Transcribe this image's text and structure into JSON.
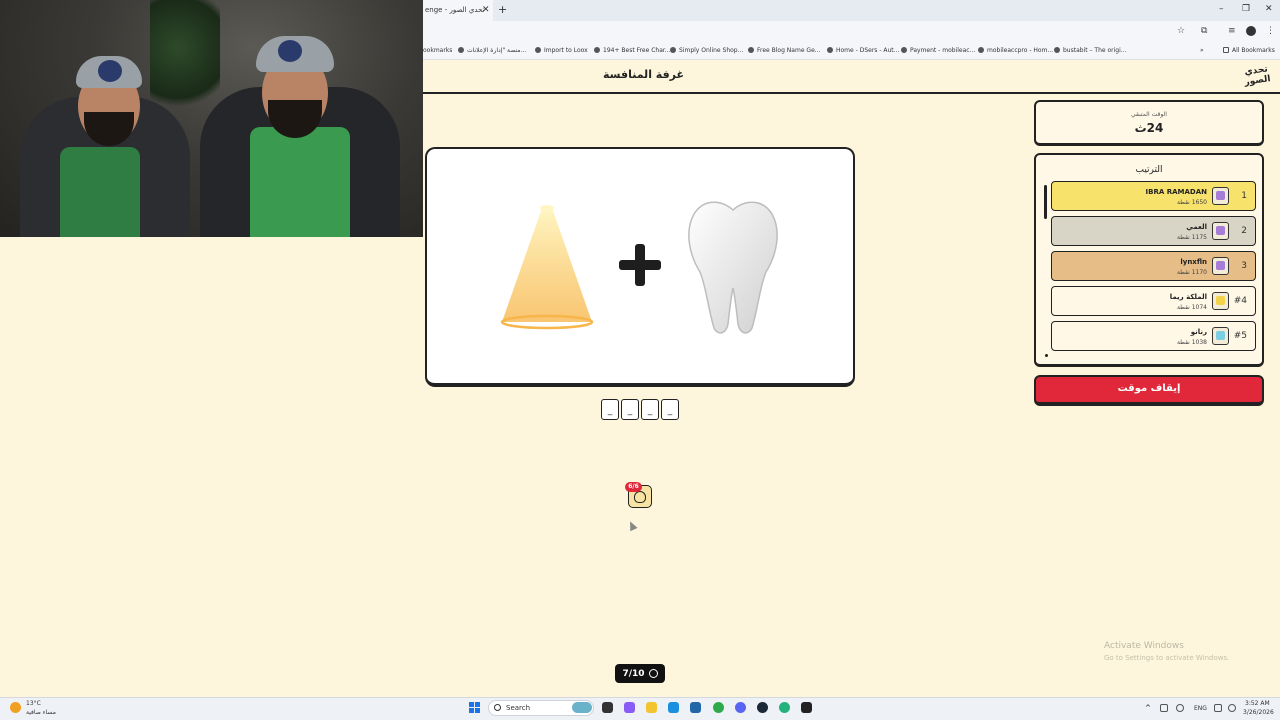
{
  "browser": {
    "tab_title": "enge - تحدي الصور",
    "tab_close": "✕",
    "new_tab": "+",
    "window_controls": [
      "–",
      "❐",
      "✕"
    ],
    "bookmarks": [
      "ookmarks",
      "منصة \"إدارة الإعلانات...",
      "Import to Loox",
      "194+ Best Free Char...",
      "Simply Online Shop...",
      "Free Blog Name Ge...",
      "Home - DSers - Aut...",
      "Payment - mobileac...",
      "mobileaccpro - Hom...",
      "bustabit – The origi..."
    ],
    "bookmarks_overflow": "»",
    "all_bookmarks": "All Bookmarks"
  },
  "app": {
    "page_title": "غرفة المنافسة",
    "brand_logo": "تحدي الصور"
  },
  "puzzle": {
    "items": [
      "spotlight",
      "plus",
      "tooth"
    ],
    "answer_slots": [
      "_",
      "_",
      "_",
      "_"
    ]
  },
  "hint": {
    "badge": "6/6"
  },
  "round": {
    "label": "7/10"
  },
  "timer": {
    "label": "الوقت المتبقي",
    "value": "24ث"
  },
  "leaderboard": {
    "title": "الترتيب",
    "rows": [
      {
        "rank": "1",
        "name": "IBRA RAMADAN",
        "score": "1650 نقطة",
        "color": "#f7e26b",
        "avatar": "av-purple"
      },
      {
        "rank": "2",
        "name": "العمي",
        "score": "1175 نقطة",
        "color": "#d9d5c6",
        "avatar": "av-purple"
      },
      {
        "rank": "3",
        "name": "lynxfln",
        "score": "1170 نقطة",
        "color": "#e6bc87",
        "avatar": "av-purple"
      },
      {
        "rank": "#4",
        "name": "الملكة ريما",
        "score": "1074 نقطة",
        "color": "#fff8e6",
        "avatar": "av-yellow"
      },
      {
        "rank": "#5",
        "name": "رنانو",
        "score": "1038 نقطة",
        "color": "#fff8e6",
        "avatar": "av-cyan"
      }
    ]
  },
  "actions": {
    "stop_timer": "إيقاف موقت"
  },
  "watermark": {
    "title": "Activate Windows",
    "subtitle": "Go to Settings to activate Windows."
  },
  "taskbar": {
    "weather_temp": "13°C",
    "weather_desc": "مساء صافية",
    "search_placeholder": "Search",
    "language": "ENG",
    "time": "3:52 AM",
    "date": "3/26/2026"
  }
}
